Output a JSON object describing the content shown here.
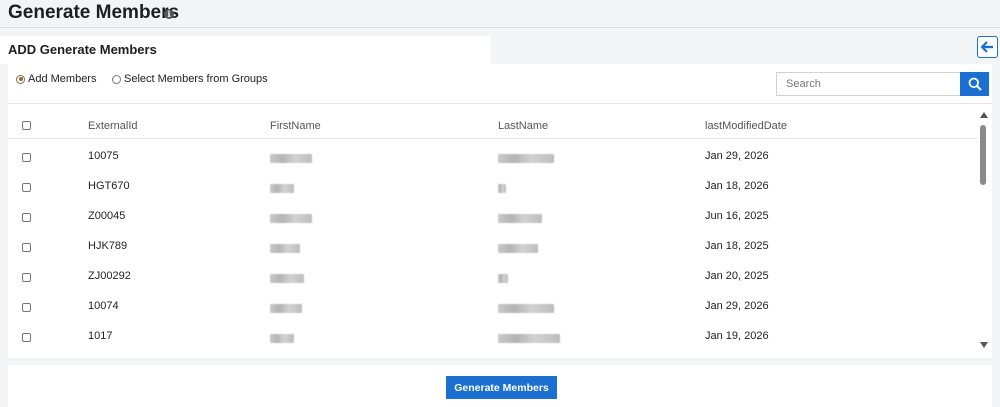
{
  "page": {
    "title": "Generate Members"
  },
  "section": {
    "title": "ADD Generate Members"
  },
  "options": {
    "add_members": "Add Members",
    "select_from_groups": "Select Members from Groups",
    "selected": "add_members"
  },
  "search": {
    "placeholder": "Search",
    "value": ""
  },
  "table": {
    "headers": [
      "ExternalId",
      "FirstName",
      "LastName",
      "lastModifiedDate"
    ],
    "rows": [
      {
        "external_id": "10075",
        "last_modified": "Jan 29, 2026"
      },
      {
        "external_id": "HGT670",
        "last_modified": "Jan 18, 2026"
      },
      {
        "external_id": "Z00045",
        "last_modified": "Jun 16, 2025"
      },
      {
        "external_id": "HJK789",
        "last_modified": "Jan 18, 2025"
      },
      {
        "external_id": "ZJ00292",
        "last_modified": "Jan 20, 2025"
      },
      {
        "external_id": "10074",
        "last_modified": "Jan 29, 2026"
      },
      {
        "external_id": "1017",
        "last_modified": "Jan 19, 2026"
      }
    ]
  },
  "footer": {
    "generate_label": "Generate Members"
  },
  "colors": {
    "accent": "#1a6fd1",
    "page_bg": "#f3f4f6",
    "panel_bg": "#ffffff"
  },
  "icons": {
    "info": "info-icon",
    "back": "arrow-left-icon",
    "search": "search-icon"
  }
}
